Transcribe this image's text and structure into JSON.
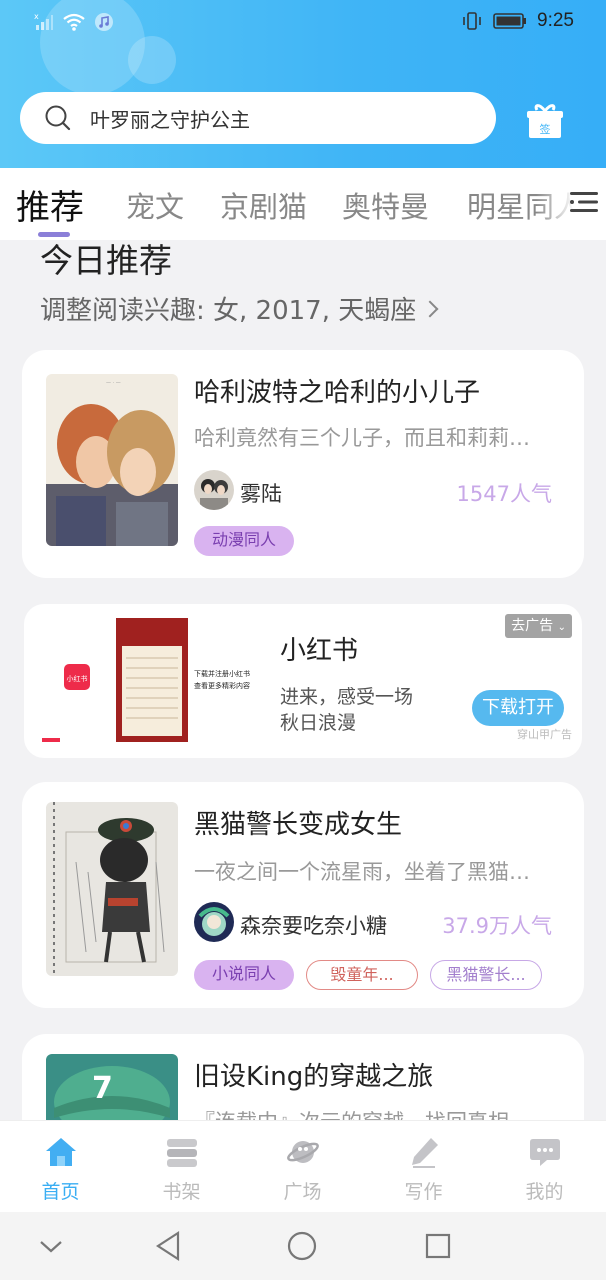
{
  "status_bar": {
    "time": "9:25",
    "icons": [
      "signal-icon",
      "wifi-icon",
      "music-icon",
      "vibrate-icon",
      "battery-icon"
    ]
  },
  "search": {
    "value": "叶罗丽之守护公主"
  },
  "header": {
    "signin_label": "签"
  },
  "tabs": [
    {
      "label": "推荐",
      "active": true
    },
    {
      "label": "宠文",
      "active": false
    },
    {
      "label": "京剧猫",
      "active": false
    },
    {
      "label": "奥特曼",
      "active": false
    },
    {
      "label": "明星同人",
      "active": false
    }
  ],
  "section": {
    "title": "今日推荐",
    "subtitle": "调整阅读兴趣: 女, 2017, 天蝎座"
  },
  "books": [
    {
      "title": "哈利波特之哈利的小儿子",
      "desc": "哈利竟然有三个儿子，而且和莉莉…",
      "author": "雾陆",
      "popularity": "1547人气",
      "tags": [
        "动漫同人"
      ]
    },
    {
      "title": "黑猫警长变成女生",
      "desc": "一夜之间一个流星雨，坐着了黑猫…",
      "author": "森奈要吃奈小糖",
      "popularity": "37.9万人气",
      "tags": [
        "小说同人",
        "毁童年...",
        "黑猫警长..."
      ]
    },
    {
      "title": "旧设King的穿越之旅",
      "desc": "『连载中』次元的穿越，找回真相…",
      "author": "",
      "popularity": "",
      "tags": []
    }
  ],
  "ad": {
    "title": "小红书",
    "text_line1": "进来，感受一场",
    "text_line2": "秋日浪漫",
    "close_label": "去广告",
    "cta": "下载打开",
    "source": "穿山甲广告",
    "logo_text": "小红书",
    "poster_text": "下载并注册小红书\n查看更多精彩内容"
  },
  "bottom_nav": [
    {
      "label": "首页",
      "icon": "home-icon",
      "active": true
    },
    {
      "label": "书架",
      "icon": "bookshelf-icon",
      "active": false
    },
    {
      "label": "广场",
      "icon": "planet-icon",
      "active": false
    },
    {
      "label": "写作",
      "icon": "pen-icon",
      "active": false
    },
    {
      "label": "我的",
      "icon": "chat-icon",
      "active": false
    }
  ],
  "colors": {
    "header_gradient_start": "#5cc8f7",
    "header_gradient_end": "#36aef7",
    "tab_indicator": "#8b7fd8",
    "popularity": "#c8a8e8",
    "nav_active": "#3aaef3",
    "cta": "#56b9ef"
  }
}
